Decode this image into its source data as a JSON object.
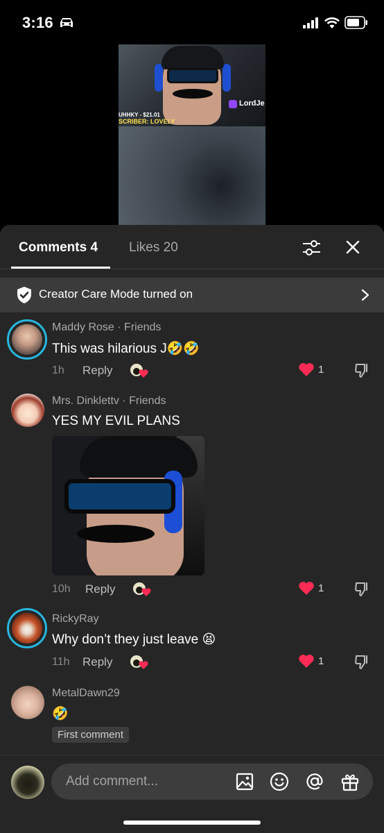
{
  "status_bar": {
    "time": "3:16"
  },
  "video": {
    "streamer_tag": "LordJe",
    "overlay_line1": "UHHKY - $21.01",
    "overlay_line2": "SCRIBER: LOVELY"
  },
  "tabs": {
    "comments": "Comments 4",
    "likes": "Likes 20"
  },
  "banner": {
    "text": "Creator Care Mode turned on"
  },
  "comments": [
    {
      "user": "Maddy Rose · Friends",
      "text": "This was hilarious J🤣🤣",
      "time": "1h",
      "reply": "Reply",
      "likes": "1"
    },
    {
      "user": "Mrs. Dinklettv · Friends",
      "text": "YES MY EVIL PLANS",
      "time": "10h",
      "reply": "Reply",
      "likes": "1"
    },
    {
      "user": "RickyRay",
      "text": "Why don’t they just leave 😫",
      "time": "11h",
      "reply": "Reply",
      "likes": "1"
    },
    {
      "user": "MetalDawn29",
      "text": "🤣",
      "badge": "First comment"
    }
  ],
  "input": {
    "placeholder": "Add comment..."
  },
  "colors": {
    "accent_ring": "#27b7e0",
    "heart": "#fe2c55",
    "sheet_bg": "#262626"
  }
}
